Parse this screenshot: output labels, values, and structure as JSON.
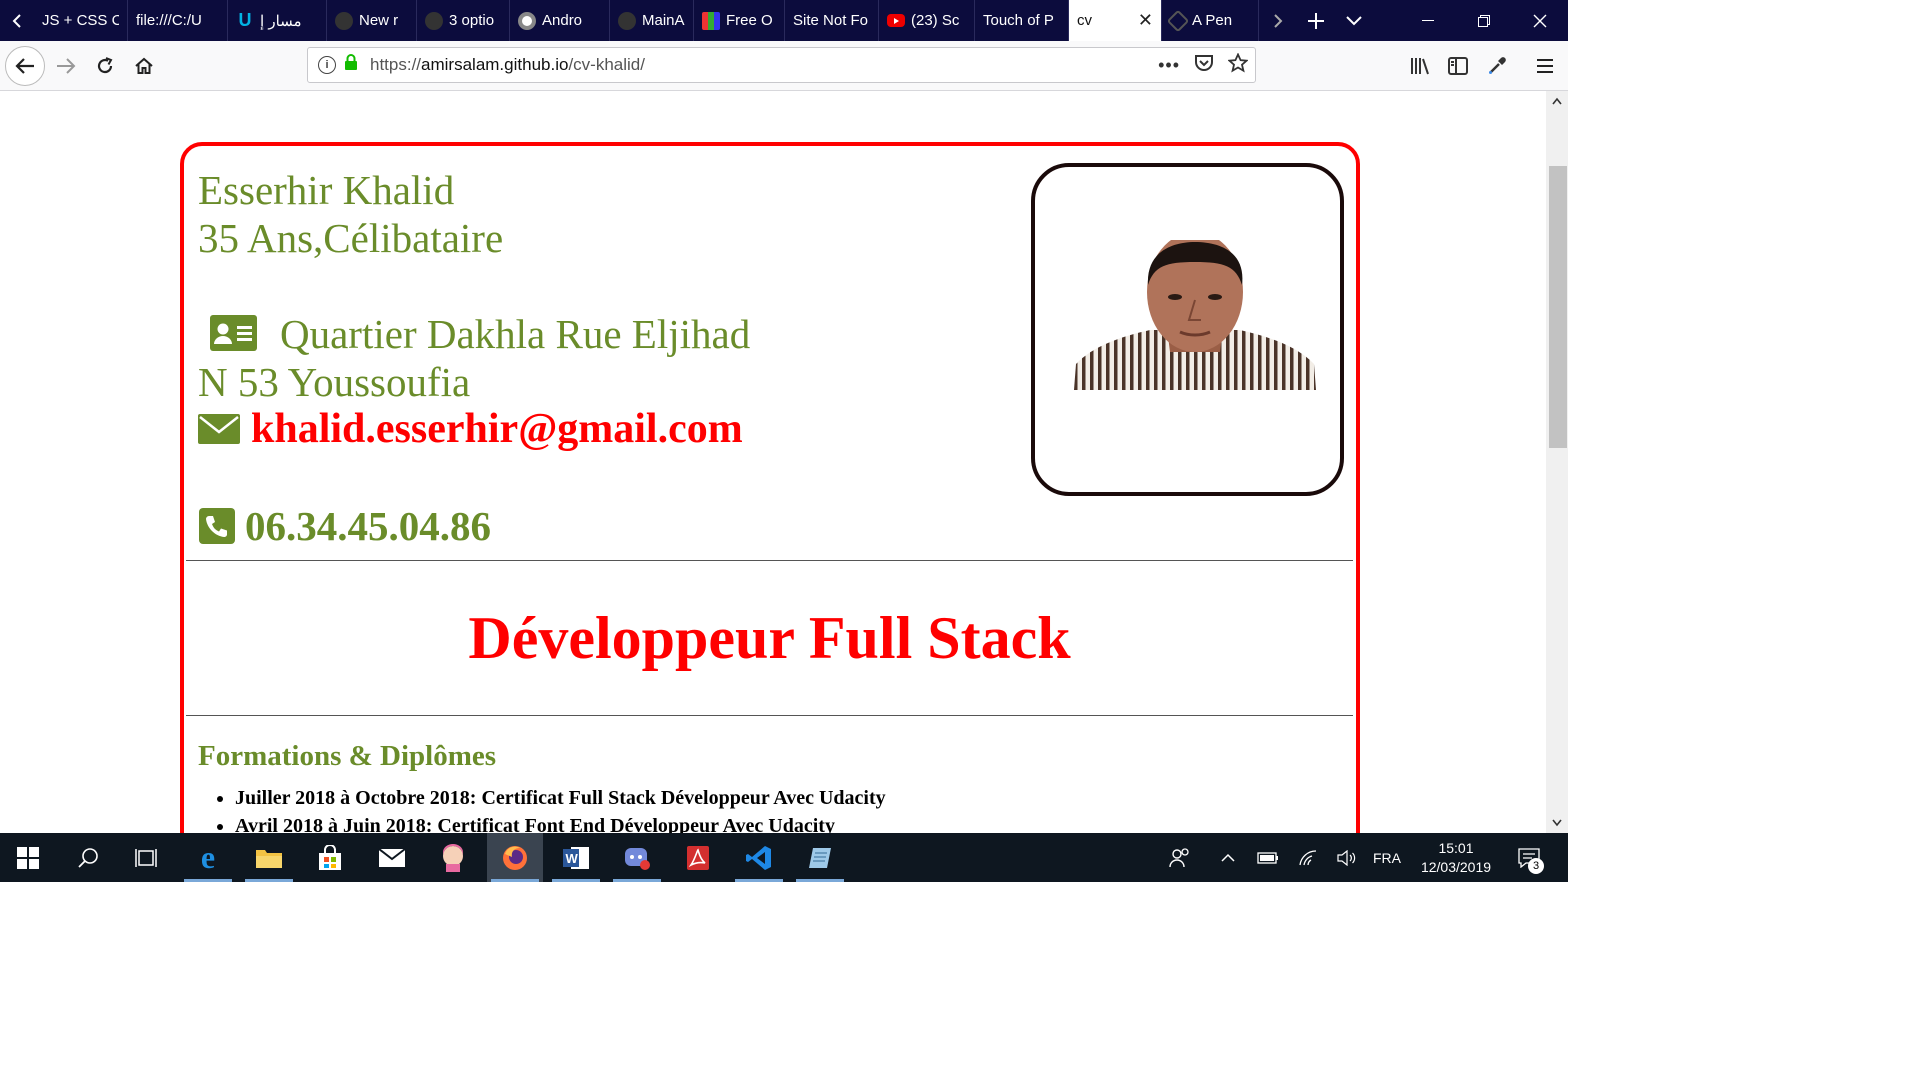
{
  "browser": {
    "tabs": [
      {
        "label": "JS + CSS C",
        "icon": "generic-page-icon"
      },
      {
        "label": "file:///C:/U",
        "icon": "file-icon"
      },
      {
        "label": "مسار إ",
        "icon": "udacity-icon"
      },
      {
        "label": "New r",
        "icon": "github-icon"
      },
      {
        "label": "3 optio",
        "icon": "github-icon"
      },
      {
        "label": "Andro",
        "icon": "chrome-icon"
      },
      {
        "label": "MainA",
        "icon": "github-icon"
      },
      {
        "label": "Free O",
        "icon": "grid-icon"
      },
      {
        "label": "Site Not Fo",
        "icon": ""
      },
      {
        "label": "(23) Sc",
        "icon": "youtube-icon"
      },
      {
        "label": "Touch of P",
        "icon": ""
      },
      {
        "label": "cv",
        "icon": "",
        "active": true
      },
      {
        "label": "A Pen",
        "icon": "codepen-icon"
      }
    ],
    "url_scheme": "https://",
    "url_host": "amirsalam.github.io",
    "url_path": "/cv-khalid/"
  },
  "cv": {
    "name": "Esserhir Khalid",
    "age_status": "35 Ans,Célibataire",
    "address_line1": "Quartier Dakhla Rue Eljihad",
    "address_line2": "N 53 Youssoufia",
    "email": "khalid.esserhir@gmail.com",
    "phone": "06.34.45.04.86",
    "job_title": "Développeur Full Stack",
    "section_formations": "Formations & Diplômes",
    "formations": [
      "Juiller 2018 à Octobre 2018: Certificat Full Stack Développeur Avec Udacity",
      "Avril 2018 à Juin 2018: Certificat Font End Développeur Avec Udacity"
    ]
  },
  "taskbar": {
    "language": "FRA",
    "time": "15:01",
    "date": "12/03/2019",
    "notifications": "3"
  },
  "colors": {
    "accent_green": "#6a8c2a",
    "accent_red": "#ff0000",
    "tabstrip_bg": "#0c0c3d",
    "taskbar_bg": "#0e1720"
  }
}
